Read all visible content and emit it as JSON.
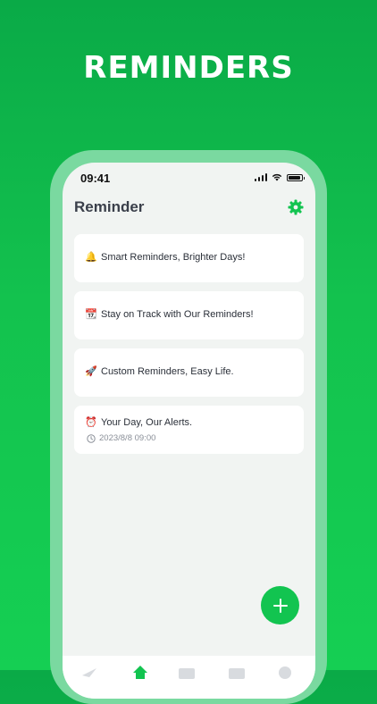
{
  "headline": "REMINDERS",
  "status_bar": {
    "time": "09:41"
  },
  "app": {
    "title": "Reminder"
  },
  "reminders": [
    {
      "emoji": "🔔",
      "text": "Smart Reminders, Brighter Days!"
    },
    {
      "emoji": "📆",
      "text": "Stay on Track with Our Reminders!"
    },
    {
      "emoji": "🚀",
      "text": "Custom Reminders, Easy Life."
    },
    {
      "emoji": "⏰",
      "text": "Your Day, Our Alerts.",
      "time": "2023/8/8 09:00"
    }
  ],
  "icons": {
    "settings": "gear-icon",
    "add": "plus-icon",
    "clock": "clock-icon"
  },
  "colors": {
    "accent": "#12c450",
    "background_top": "#0aaa47",
    "background_bottom": "#15cf53",
    "title_text": "#3a3f4a"
  }
}
